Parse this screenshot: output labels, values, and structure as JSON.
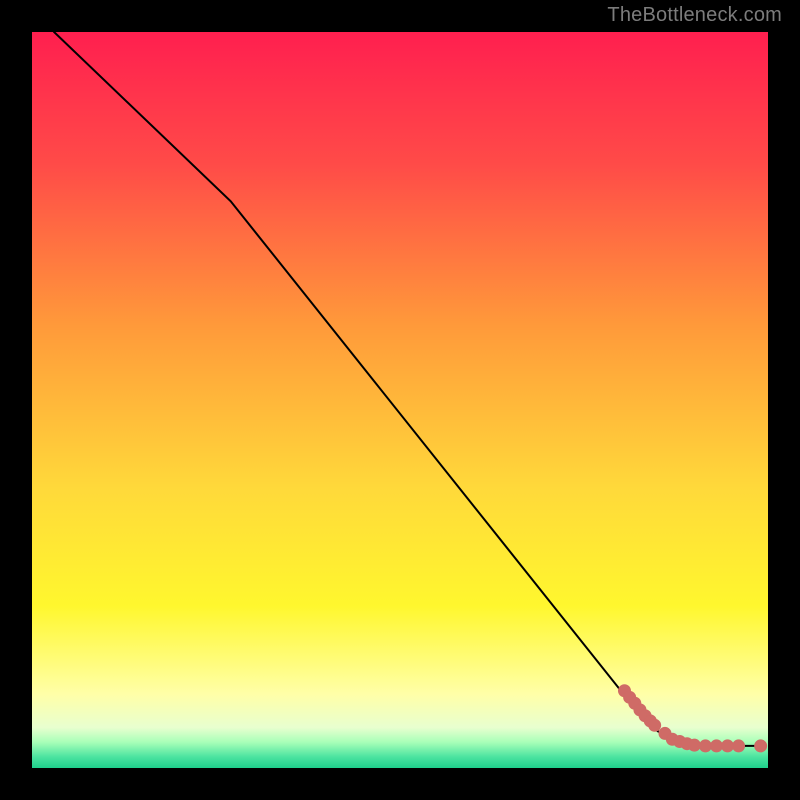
{
  "attribution": "TheBottleneck.com",
  "chart_data": {
    "type": "line",
    "xlim": [
      0,
      100
    ],
    "ylim": [
      0,
      100
    ],
    "curve": [
      {
        "x": 3,
        "y": 100
      },
      {
        "x": 27,
        "y": 77
      },
      {
        "x": 82,
        "y": 8
      },
      {
        "x": 85,
        "y": 5
      },
      {
        "x": 88,
        "y": 3.5
      },
      {
        "x": 92,
        "y": 3
      },
      {
        "x": 97,
        "y": 3
      },
      {
        "x": 99,
        "y": 3
      }
    ],
    "points": [
      {
        "x": 80.5,
        "y": 10.5
      },
      {
        "x": 81.2,
        "y": 9.6
      },
      {
        "x": 81.9,
        "y": 8.8
      },
      {
        "x": 82.6,
        "y": 7.9
      },
      {
        "x": 83.3,
        "y": 7.1
      },
      {
        "x": 84.0,
        "y": 6.4
      },
      {
        "x": 84.6,
        "y": 5.8
      },
      {
        "x": 86.0,
        "y": 4.7
      },
      {
        "x": 87.0,
        "y": 3.9
      },
      {
        "x": 88.0,
        "y": 3.6
      },
      {
        "x": 89.0,
        "y": 3.3
      },
      {
        "x": 90.0,
        "y": 3.1
      },
      {
        "x": 91.5,
        "y": 3.0
      },
      {
        "x": 93.0,
        "y": 3.0
      },
      {
        "x": 94.5,
        "y": 3.0
      },
      {
        "x": 96.0,
        "y": 3.0
      },
      {
        "x": 99.0,
        "y": 3.0
      }
    ],
    "style": {
      "background_gradient": [
        {
          "offset": 0.0,
          "color": "#ff1f4f"
        },
        {
          "offset": 0.18,
          "color": "#ff4b48"
        },
        {
          "offset": 0.4,
          "color": "#ff9a3a"
        },
        {
          "offset": 0.62,
          "color": "#ffd93a"
        },
        {
          "offset": 0.78,
          "color": "#fff72e"
        },
        {
          "offset": 0.9,
          "color": "#ffffa8"
        },
        {
          "offset": 0.945,
          "color": "#e8ffcf"
        },
        {
          "offset": 0.965,
          "color": "#a8ffb8"
        },
        {
          "offset": 0.985,
          "color": "#4be3a0"
        },
        {
          "offset": 1.0,
          "color": "#1fd08c"
        }
      ],
      "line_color": "#000000",
      "point_fill": "#cf6b66",
      "point_stroke": "#cf6b66",
      "point_radius": 6
    }
  }
}
